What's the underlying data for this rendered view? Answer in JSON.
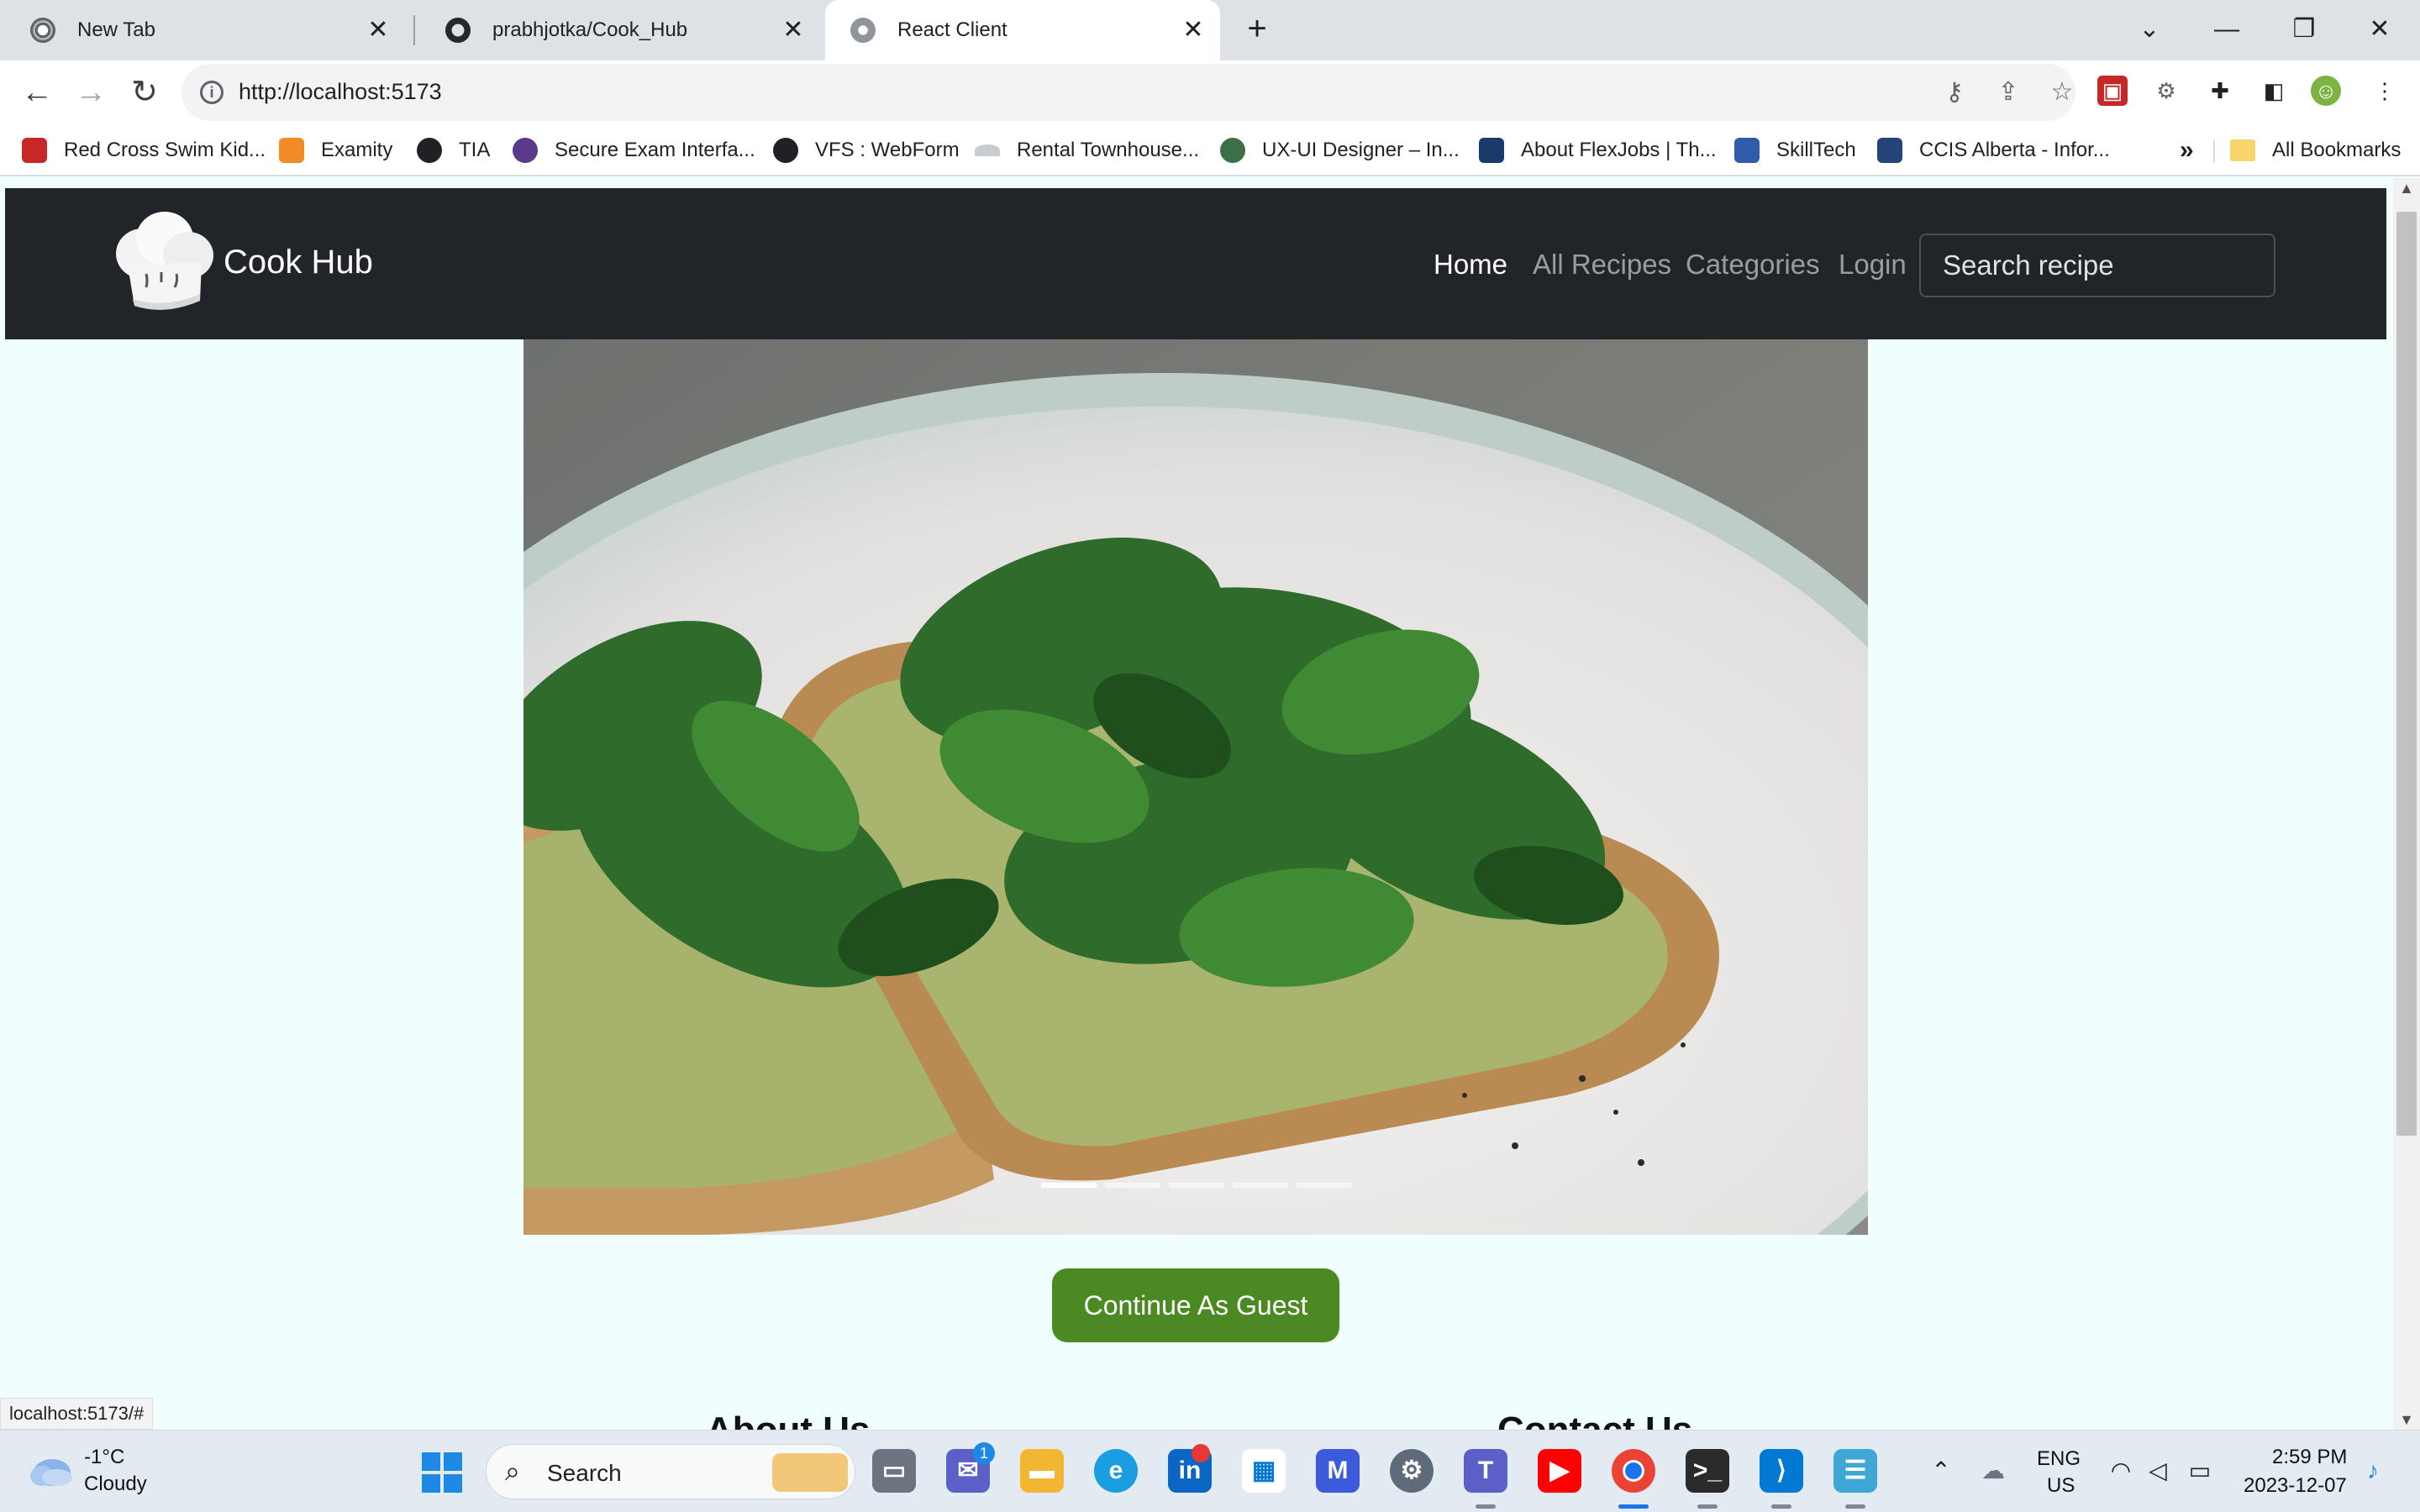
{
  "browser": {
    "tabs": [
      {
        "title": "New Tab",
        "icon": "chrome-icon"
      },
      {
        "title": "prabhjotka/Cook_Hub",
        "icon": "github-icon"
      },
      {
        "title": "React Client",
        "icon": "globe-icon"
      }
    ],
    "active_tab": 2,
    "tab_close_glyph": "✕",
    "new_tab_glyph": "+",
    "url": "http://localhost:5173",
    "bookmarks": [
      {
        "label": "Red Cross Swim Kid...",
        "color": "#c62828"
      },
      {
        "label": "Examity",
        "color": "#f28b25"
      },
      {
        "label": "TIA",
        "color": "#202124"
      },
      {
        "label": "Secure Exam Interfa...",
        "color": "#5b3a8c"
      },
      {
        "label": "VFS : WebForm",
        "color": "#202124"
      },
      {
        "label": "Rental Townhouse...",
        "color": "#9aa0a6"
      },
      {
        "label": "UX-UI Designer – In...",
        "color": "#3c6e47"
      },
      {
        "label": "About FlexJobs | Th...",
        "color": "#1a3a6b"
      },
      {
        "label": "SkillTech",
        "color": "#2f5ba8"
      },
      {
        "label": "CCIS Alberta - Infor...",
        "color": "#25457a"
      }
    ],
    "bookmarks_overflow": "»",
    "all_bookmarks": "All Bookmarks",
    "status_url": "localhost:5173/#"
  },
  "site": {
    "brand": "Cook Hub",
    "nav": [
      {
        "label": "Home",
        "active": true
      },
      {
        "label": "All Recipes",
        "active": false
      },
      {
        "label": "Categories",
        "active": false
      },
      {
        "label": "Login",
        "active": false
      }
    ],
    "search_placeholder": "Search recipe",
    "carousel": {
      "slide_count": 5,
      "active_index": 0,
      "image": "spinach and avocado toast on a plate"
    },
    "guest_button": "Continue As Guest",
    "sections": [
      "About Us",
      "Contact Us"
    ],
    "colors": {
      "navbar": "#212529",
      "page_bg": "#f0fffe",
      "guest_button": "#4b8a23"
    }
  },
  "taskbar": {
    "weather_temp": "-1°C",
    "weather_desc": "Cloudy",
    "search_label": "Search",
    "apps": [
      "windows-start-icon",
      "task-view-icon",
      "teams-chat-icon",
      "file-explorer-icon",
      "edge-icon",
      "linkedin-icon",
      "ms-store-icon",
      "visual-studio-icon",
      "settings-icon",
      "teams-icon",
      "youtube-icon",
      "chrome-icon",
      "terminal-icon",
      "vscode-icon",
      "notepad-icon"
    ],
    "chat_badge": "1",
    "lang_line1": "ENG",
    "lang_line2": "US",
    "time": "2:59 PM",
    "date": "2023-12-07"
  }
}
